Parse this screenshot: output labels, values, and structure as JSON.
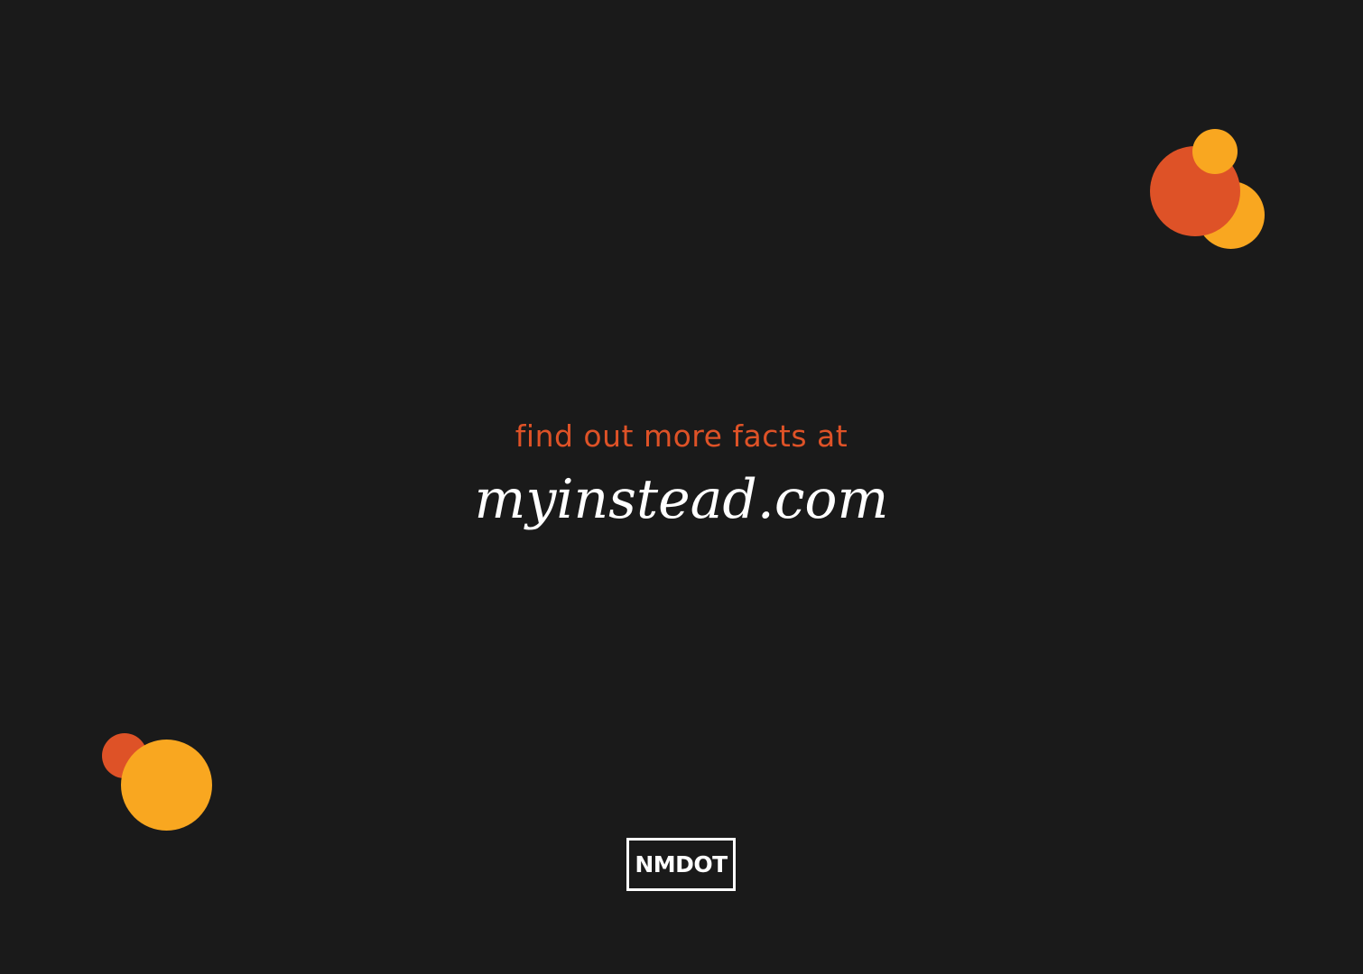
{
  "tagline": "find out more facts at",
  "url": "myinstead.com",
  "logo": "NMDOT",
  "colors": {
    "background": "#1a1a1a",
    "orange": "#de5227",
    "yellow": "#f9a720",
    "text": "#ffffff"
  }
}
